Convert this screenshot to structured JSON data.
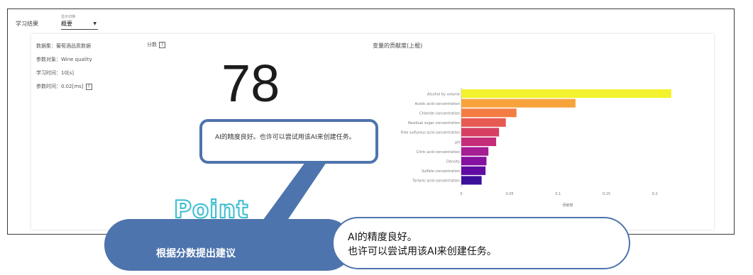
{
  "header": {
    "title": "学习结果",
    "display_label": "显示切换",
    "display_value": "概要"
  },
  "info": {
    "dataset": "数据集：葡萄酒品质数据",
    "target": "参数对象：Wine quality",
    "train_time": "学习时间：10[s]",
    "infer_time": "参数时间：0.02[ms]",
    "help": "?"
  },
  "score": {
    "label": "分数",
    "help": "?",
    "value": "78"
  },
  "chart_data": {
    "type": "bar",
    "orientation": "horizontal",
    "title": "变量的贡献度(上棍)",
    "xlabel": "贡献度",
    "ylabel": "",
    "xlim": [
      0,
      0.22
    ],
    "xticks": [
      "0",
      "0.05",
      "0.1",
      "0.15",
      "0.2"
    ],
    "categories": [
      "Alcohol by volume",
      "Acetic acid concentration",
      "Chloride concentration",
      "Residual sugar concentration",
      "Free sulfurous acid concentration",
      "pH",
      "Citric acid concentration",
      "Density",
      "Sulfate concentration",
      "Tartaric acid concentration"
    ],
    "values": [
      0.217,
      0.118,
      0.057,
      0.046,
      0.039,
      0.036,
      0.028,
      0.026,
      0.025,
      0.021
    ],
    "colors": [
      "#f3f22e",
      "#f7a33c",
      "#f27c42",
      "#e65a52",
      "#d63f62",
      "#c42b79",
      "#a51c93",
      "#8610a0",
      "#620ba3",
      "#3d0f9a"
    ]
  },
  "bubble": {
    "text": "AI的精度良好。也许可以尝试用该AI来创建任务。"
  },
  "callout": {
    "point": "Point",
    "left_label": "根据分数提出建议",
    "right_line1": "AI的精度良好。",
    "right_line2": "也许可以尝试用该AI来创建任务。"
  }
}
